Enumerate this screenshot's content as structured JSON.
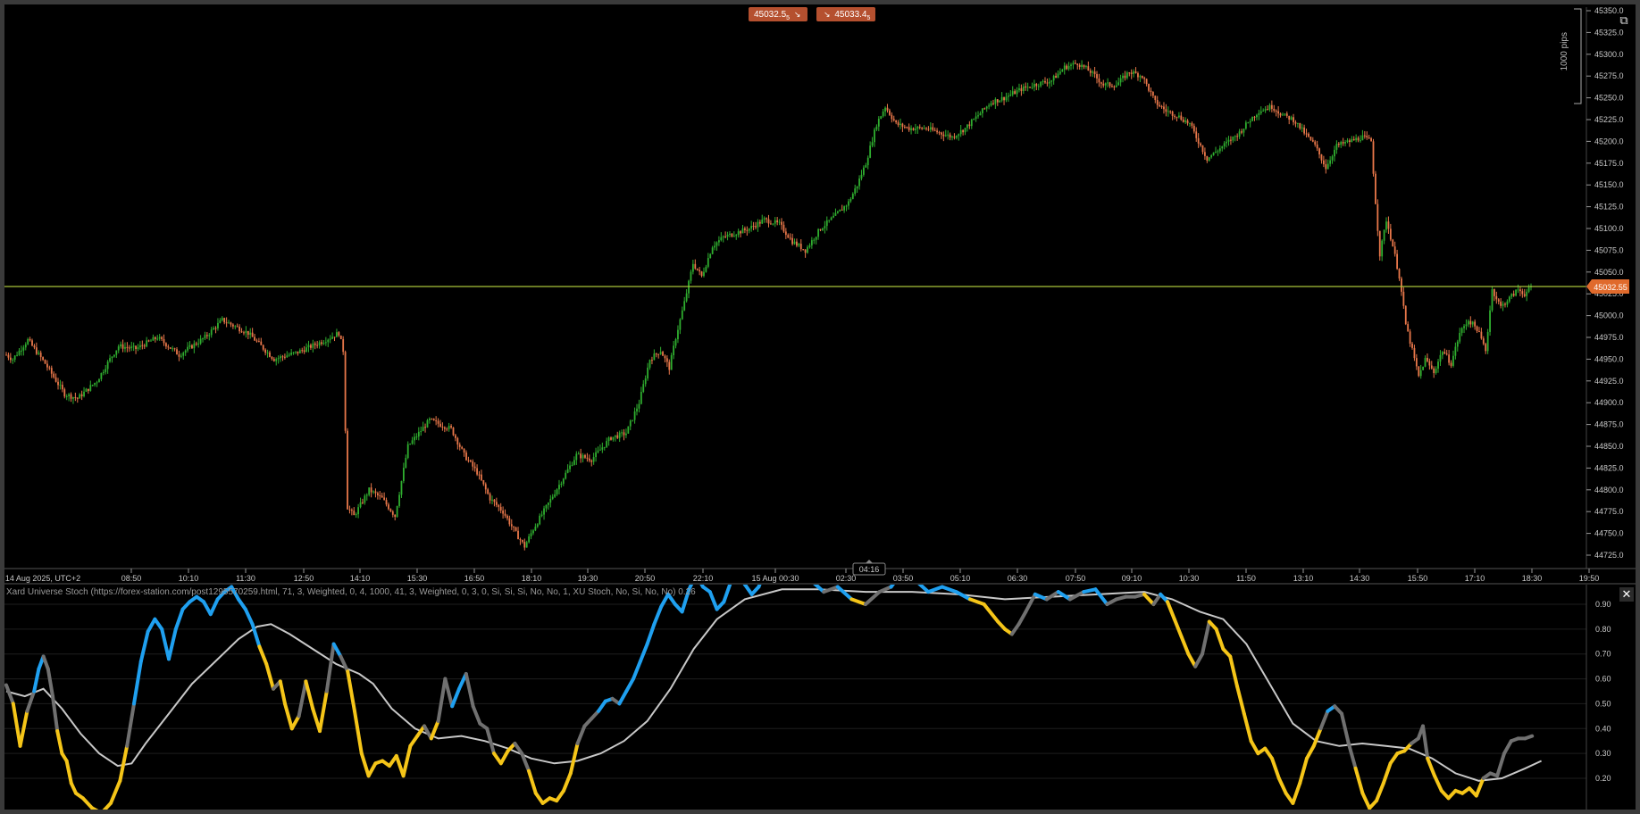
{
  "top_badges": {
    "bid_price": "45032.5",
    "bid_sup": "5",
    "bid_arrow": "↘",
    "ask_arrow": "↘",
    "ask_price": "45033.4",
    "ask_sup": "5"
  },
  "scale": {
    "pips_label": "1000 pips",
    "current_price": "45032.55",
    "price_ticks": [
      "45350.0",
      "45325.0",
      "45300.0",
      "45275.0",
      "45250.0",
      "45225.0",
      "45200.0",
      "45175.0",
      "45150.0",
      "45125.0",
      "45100.0",
      "45075.0",
      "45050.0",
      "45025.0",
      "45000.0",
      "44975.0",
      "44950.0",
      "44925.0",
      "44900.0",
      "44875.0",
      "44850.0",
      "44825.0",
      "44800.0",
      "44775.0",
      "44750.0",
      "44725.0"
    ],
    "time_ticks": [
      "14 Aug 2025, UTC+2",
      "08:50",
      "10:10",
      "11:30",
      "12:50",
      "14:10",
      "15:30",
      "16:50",
      "18:10",
      "19:30",
      "20:50",
      "22:10",
      "15 Aug 00:30",
      "02:30",
      "03:50",
      "05:10",
      "06:30",
      "07:50",
      "09:10",
      "10:30",
      "11:50",
      "13:10",
      "14:30",
      "15:50",
      "17:10",
      "18:30",
      "19:50"
    ],
    "countdown": "04:16"
  },
  "indicator": {
    "label": "Xard Universe Stoch (https://forex-station.com/post1295570259.html, 71, 3, Weighted, 0, 4, 1000, 41, 3, Weighted, 0, 3, 0, Si, Si, Si, No, No, 1, XU Stoch, No, Si, No, No) 0.26",
    "ticks": [
      "0.90",
      "0.80",
      "0.70",
      "0.60",
      "0.50",
      "0.40",
      "0.30",
      "0.20"
    ],
    "close_icon": "close-icon"
  },
  "colors": {
    "background": "#000000",
    "bull_candle": "#2fae2f",
    "bear_candle": "#e8774a",
    "price_line": "#a8c43a",
    "badge": "#b5502f",
    "stoch_up": "#1fa0f0",
    "stoch_down": "#f5c518",
    "stoch_neutral": "#707070",
    "signal": "#c8c8c8"
  },
  "chart_data": {
    "type": "candlestick",
    "title": "",
    "ylim": [
      44712,
      45357
    ],
    "price_anchors": [
      [
        0,
        44955
      ],
      [
        3,
        44950
      ],
      [
        10,
        44972
      ],
      [
        18,
        44945
      ],
      [
        27,
        44910
      ],
      [
        33,
        44905
      ],
      [
        42,
        44925
      ],
      [
        48,
        44950
      ],
      [
        52,
        44965
      ],
      [
        60,
        44962
      ],
      [
        70,
        44975
      ],
      [
        80,
        44955
      ],
      [
        92,
        44975
      ],
      [
        100,
        44995
      ],
      [
        112,
        44980
      ],
      [
        124,
        44950
      ],
      [
        135,
        44958
      ],
      [
        146,
        44970
      ],
      [
        154,
        44980
      ],
      [
        156,
        44960
      ],
      [
        158,
        44780
      ],
      [
        161,
        44770
      ],
      [
        168,
        44800
      ],
      [
        174,
        44790
      ],
      [
        180,
        44770
      ],
      [
        186,
        44850
      ],
      [
        196,
        44880
      ],
      [
        206,
        44870
      ],
      [
        212,
        44840
      ],
      [
        218,
        44820
      ],
      [
        224,
        44790
      ],
      [
        230,
        44775
      ],
      [
        236,
        44750
      ],
      [
        240,
        44735
      ],
      [
        244,
        44755
      ],
      [
        250,
        44780
      ],
      [
        257,
        44810
      ],
      [
        264,
        44840
      ],
      [
        271,
        44835
      ],
      [
        280,
        44860
      ],
      [
        287,
        44865
      ],
      [
        293,
        44900
      ],
      [
        298,
        44950
      ],
      [
        303,
        44960
      ],
      [
        307,
        44940
      ],
      [
        310,
        44975
      ],
      [
        314,
        45015
      ],
      [
        318,
        45060
      ],
      [
        322,
        45045
      ],
      [
        327,
        45080
      ],
      [
        332,
        45090
      ],
      [
        338,
        45095
      ],
      [
        344,
        45100
      ],
      [
        351,
        45110
      ],
      [
        358,
        45105
      ],
      [
        364,
        45085
      ],
      [
        370,
        45075
      ],
      [
        377,
        45100
      ],
      [
        384,
        45115
      ],
      [
        390,
        45130
      ],
      [
        394,
        45150
      ],
      [
        398,
        45175
      ],
      [
        403,
        45220
      ],
      [
        407,
        45240
      ],
      [
        412,
        45220
      ],
      [
        418,
        45215
      ],
      [
        426,
        45215
      ],
      [
        432,
        45210
      ],
      [
        438,
        45205
      ],
      [
        444,
        45215
      ],
      [
        450,
        45230
      ],
      [
        456,
        45245
      ],
      [
        462,
        45250
      ],
      [
        470,
        45260
      ],
      [
        476,
        45265
      ],
      [
        484,
        45270
      ],
      [
        490,
        45285
      ],
      [
        496,
        45290
      ],
      [
        502,
        45280
      ],
      [
        508,
        45265
      ],
      [
        514,
        45265
      ],
      [
        520,
        45280
      ],
      [
        526,
        45275
      ],
      [
        532,
        45245
      ],
      [
        537,
        45235
      ],
      [
        542,
        45230
      ],
      [
        548,
        45220
      ],
      [
        552,
        45200
      ],
      [
        556,
        45180
      ],
      [
        561,
        45190
      ],
      [
        566,
        45200
      ],
      [
        571,
        45210
      ],
      [
        576,
        45225
      ],
      [
        580,
        45235
      ],
      [
        586,
        45240
      ],
      [
        591,
        45230
      ],
      [
        596,
        45225
      ],
      [
        601,
        45210
      ],
      [
        606,
        45195
      ],
      [
        611,
        45170
      ],
      [
        616,
        45195
      ],
      [
        622,
        45200
      ],
      [
        628,
        45205
      ],
      [
        632,
        45200
      ],
      [
        634,
        45130
      ],
      [
        636,
        45070
      ],
      [
        639,
        45110
      ],
      [
        642,
        45080
      ],
      [
        645,
        45045
      ],
      [
        648,
        44990
      ],
      [
        651,
        44960
      ],
      [
        654,
        44930
      ],
      [
        657,
        44950
      ],
      [
        661,
        44935
      ],
      [
        665,
        44960
      ],
      [
        669,
        44945
      ],
      [
        673,
        44980
      ],
      [
        677,
        44995
      ],
      [
        681,
        44985
      ],
      [
        685,
        44960
      ],
      [
        688,
        45030
      ],
      [
        692,
        45010
      ],
      [
        696,
        45020
      ],
      [
        700,
        45030
      ],
      [
        703,
        45025
      ],
      [
        706,
        45032
      ]
    ],
    "stoch": [
      [
        0,
        0.575
      ],
      [
        3,
        0.5
      ],
      [
        6,
        0.33
      ],
      [
        9,
        0.47
      ],
      [
        12,
        0.55
      ],
      [
        14,
        0.64
      ],
      [
        16,
        0.69
      ],
      [
        18,
        0.64
      ],
      [
        20,
        0.53
      ],
      [
        22,
        0.39
      ],
      [
        24,
        0.3
      ],
      [
        26,
        0.27
      ],
      [
        28,
        0.18
      ],
      [
        30,
        0.14
      ],
      [
        33,
        0.12
      ],
      [
        37,
        0.08
      ],
      [
        41,
        0.06
      ],
      [
        45,
        0.1
      ],
      [
        49,
        0.19
      ],
      [
        52,
        0.33
      ],
      [
        55,
        0.5
      ],
      [
        58,
        0.67
      ],
      [
        61,
        0.79
      ],
      [
        64,
        0.84
      ],
      [
        67,
        0.8
      ],
      [
        70,
        0.68
      ],
      [
        73,
        0.8
      ],
      [
        76,
        0.88
      ],
      [
        79,
        0.91
      ],
      [
        82,
        0.93
      ],
      [
        85,
        0.91
      ],
      [
        88,
        0.86
      ],
      [
        91,
        0.92
      ],
      [
        94,
        0.95
      ],
      [
        97,
        0.97
      ],
      [
        100,
        0.92
      ],
      [
        103,
        0.88
      ],
      [
        106,
        0.82
      ],
      [
        109,
        0.73
      ],
      [
        112,
        0.66
      ],
      [
        115,
        0.56
      ],
      [
        118,
        0.59
      ],
      [
        120,
        0.5
      ],
      [
        123,
        0.4
      ],
      [
        126,
        0.45
      ],
      [
        129,
        0.59
      ],
      [
        132,
        0.48
      ],
      [
        135,
        0.39
      ],
      [
        138,
        0.55
      ],
      [
        141,
        0.74
      ],
      [
        144,
        0.69
      ],
      [
        147,
        0.63
      ],
      [
        150,
        0.47
      ],
      [
        153,
        0.3
      ],
      [
        156,
        0.21
      ],
      [
        159,
        0.26
      ],
      [
        162,
        0.27
      ],
      [
        165,
        0.25
      ],
      [
        168,
        0.29
      ],
      [
        171,
        0.21
      ],
      [
        174,
        0.33
      ],
      [
        177,
        0.37
      ],
      [
        180,
        0.41
      ],
      [
        183,
        0.36
      ],
      [
        186,
        0.43
      ],
      [
        189,
        0.6
      ],
      [
        192,
        0.49
      ],
      [
        195,
        0.56
      ],
      [
        198,
        0.62
      ],
      [
        201,
        0.49
      ],
      [
        204,
        0.42
      ],
      [
        207,
        0.4
      ],
      [
        210,
        0.3
      ],
      [
        213,
        0.26
      ],
      [
        216,
        0.31
      ],
      [
        219,
        0.34
      ],
      [
        222,
        0.3
      ],
      [
        225,
        0.23
      ],
      [
        228,
        0.14
      ],
      [
        231,
        0.1
      ],
      [
        234,
        0.12
      ],
      [
        237,
        0.11
      ],
      [
        240,
        0.15
      ],
      [
        243,
        0.22
      ],
      [
        246,
        0.34
      ],
      [
        249,
        0.41
      ],
      [
        252,
        0.44
      ],
      [
        255,
        0.47
      ],
      [
        258,
        0.51
      ],
      [
        261,
        0.52
      ],
      [
        264,
        0.5
      ],
      [
        267,
        0.55
      ],
      [
        270,
        0.6
      ],
      [
        273,
        0.67
      ],
      [
        276,
        0.74
      ],
      [
        279,
        0.82
      ],
      [
        282,
        0.89
      ],
      [
        285,
        0.94
      ],
      [
        288,
        0.9
      ],
      [
        291,
        0.87
      ],
      [
        294,
        0.96
      ],
      [
        297,
        1.02
      ],
      [
        300,
        0.97
      ],
      [
        303,
        0.95
      ],
      [
        306,
        0.88
      ],
      [
        309,
        0.91
      ],
      [
        312,
        0.99
      ],
      [
        315,
        1.03
      ],
      [
        318,
        0.98
      ],
      [
        321,
        0.94
      ],
      [
        324,
        0.97
      ],
      [
        327,
        1.04
      ],
      [
        333,
        1.02
      ],
      [
        340,
        1.0
      ],
      [
        346,
        1.0
      ],
      [
        352,
        0.95
      ],
      [
        358,
        0.97
      ],
      [
        364,
        0.92
      ],
      [
        370,
        0.9
      ],
      [
        376,
        0.95
      ],
      [
        381,
        0.97
      ],
      [
        385,
        1.02
      ],
      [
        391,
        1.0
      ],
      [
        397,
        0.95
      ],
      [
        403,
        0.97
      ],
      [
        409,
        0.95
      ],
      [
        415,
        0.92
      ],
      [
        421,
        0.9
      ],
      [
        427,
        0.83
      ],
      [
        430,
        0.8
      ],
      [
        433,
        0.78
      ],
      [
        436,
        0.82
      ],
      [
        439,
        0.87
      ],
      [
        443,
        0.94
      ],
      [
        448,
        0.92
      ],
      [
        453,
        0.95
      ],
      [
        458,
        0.92
      ],
      [
        464,
        0.95
      ],
      [
        469,
        0.96
      ],
      [
        474,
        0.9
      ],
      [
        478,
        0.92
      ],
      [
        482,
        0.93
      ],
      [
        486,
        0.93
      ],
      [
        490,
        0.94
      ],
      [
        494,
        0.9
      ],
      [
        497,
        0.94
      ],
      [
        500,
        0.91
      ],
      [
        503,
        0.84
      ],
      [
        506,
        0.77
      ],
      [
        509,
        0.7
      ],
      [
        512,
        0.65
      ],
      [
        515,
        0.7
      ],
      [
        518,
        0.83
      ],
      [
        521,
        0.8
      ],
      [
        524,
        0.72
      ],
      [
        527,
        0.69
      ],
      [
        530,
        0.57
      ],
      [
        533,
        0.46
      ],
      [
        536,
        0.35
      ],
      [
        539,
        0.3
      ],
      [
        542,
        0.32
      ],
      [
        545,
        0.28
      ],
      [
        548,
        0.2
      ],
      [
        551,
        0.14
      ],
      [
        554,
        0.1
      ],
      [
        557,
        0.18
      ],
      [
        560,
        0.28
      ],
      [
        563,
        0.33
      ],
      [
        566,
        0.4
      ],
      [
        569,
        0.47
      ],
      [
        572,
        0.49
      ],
      [
        575,
        0.46
      ],
      [
        578,
        0.34
      ],
      [
        581,
        0.24
      ],
      [
        584,
        0.14
      ],
      [
        587,
        0.08
      ],
      [
        590,
        0.11
      ],
      [
        593,
        0.18
      ],
      [
        596,
        0.26
      ],
      [
        599,
        0.3
      ],
      [
        602,
        0.31
      ],
      [
        605,
        0.34
      ],
      [
        608,
        0.36
      ],
      [
        610,
        0.41
      ],
      [
        612,
        0.28
      ],
      [
        615,
        0.21
      ],
      [
        618,
        0.15
      ],
      [
        621,
        0.12
      ],
      [
        624,
        0.15
      ],
      [
        627,
        0.14
      ],
      [
        630,
        0.16
      ],
      [
        633,
        0.13
      ],
      [
        636,
        0.2
      ],
      [
        639,
        0.22
      ],
      [
        642,
        0.21
      ],
      [
        645,
        0.3
      ],
      [
        648,
        0.35
      ],
      [
        651,
        0.36
      ],
      [
        654,
        0.36
      ],
      [
        657,
        0.37
      ]
    ],
    "signal": [
      [
        0,
        0.55
      ],
      [
        8,
        0.53
      ],
      [
        16,
        0.56
      ],
      [
        24,
        0.48
      ],
      [
        32,
        0.38
      ],
      [
        40,
        0.3
      ],
      [
        48,
        0.25
      ],
      [
        54,
        0.26
      ],
      [
        60,
        0.34
      ],
      [
        70,
        0.46
      ],
      [
        80,
        0.58
      ],
      [
        90,
        0.67
      ],
      [
        100,
        0.76
      ],
      [
        108,
        0.81
      ],
      [
        114,
        0.82
      ],
      [
        122,
        0.78
      ],
      [
        132,
        0.72
      ],
      [
        142,
        0.66
      ],
      [
        152,
        0.62
      ],
      [
        158,
        0.58
      ],
      [
        166,
        0.48
      ],
      [
        176,
        0.4
      ],
      [
        186,
        0.36
      ],
      [
        196,
        0.37
      ],
      [
        206,
        0.35
      ],
      [
        216,
        0.32
      ],
      [
        226,
        0.28
      ],
      [
        236,
        0.26
      ],
      [
        246,
        0.27
      ],
      [
        256,
        0.3
      ],
      [
        266,
        0.35
      ],
      [
        276,
        0.43
      ],
      [
        286,
        0.56
      ],
      [
        296,
        0.72
      ],
      [
        306,
        0.84
      ],
      [
        318,
        0.92
      ],
      [
        334,
        0.96
      ],
      [
        350,
        0.96
      ],
      [
        370,
        0.95
      ],
      [
        390,
        0.95
      ],
      [
        410,
        0.94
      ],
      [
        430,
        0.92
      ],
      [
        450,
        0.93
      ],
      [
        470,
        0.94
      ],
      [
        490,
        0.95
      ],
      [
        502,
        0.92
      ],
      [
        514,
        0.87
      ],
      [
        524,
        0.84
      ],
      [
        534,
        0.74
      ],
      [
        544,
        0.58
      ],
      [
        554,
        0.42
      ],
      [
        564,
        0.35
      ],
      [
        574,
        0.33
      ],
      [
        584,
        0.34
      ],
      [
        594,
        0.33
      ],
      [
        604,
        0.32
      ],
      [
        614,
        0.28
      ],
      [
        624,
        0.22
      ],
      [
        634,
        0.19
      ],
      [
        644,
        0.2
      ],
      [
        654,
        0.24
      ],
      [
        661,
        0.27
      ]
    ]
  }
}
